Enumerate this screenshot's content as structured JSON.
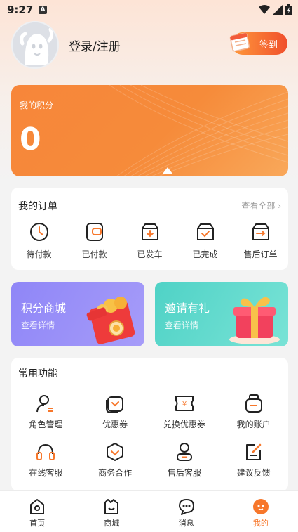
{
  "status_bar": {
    "time": "9:27",
    "notif_badge": "A"
  },
  "profile": {
    "login_text": "登录/注册",
    "signin_label": "签到"
  },
  "points": {
    "title": "我的积分",
    "value": "0"
  },
  "orders": {
    "title": "我的订单",
    "view_all": "查看全部 ›",
    "items": [
      {
        "label": "待付款",
        "icon": "clock-icon"
      },
      {
        "label": "已付款",
        "icon": "card-icon"
      },
      {
        "label": "已发车",
        "icon": "box-down-icon"
      },
      {
        "label": "已完成",
        "icon": "box-check-icon"
      },
      {
        "label": "售后订单",
        "icon": "box-return-icon"
      }
    ]
  },
  "promos": {
    "points_mall": {
      "title": "积分商城",
      "sub": "查看详情"
    },
    "invite": {
      "title": "邀请有礼",
      "sub": "查看详情"
    }
  },
  "common": {
    "title": "常用功能",
    "items": [
      {
        "label": "角色管理",
        "icon": "user-role-icon"
      },
      {
        "label": "优惠券",
        "icon": "coupon-icon"
      },
      {
        "label": "兑换优惠券",
        "icon": "ticket-yen-icon"
      },
      {
        "label": "我的账户",
        "icon": "wallet-icon"
      },
      {
        "label": "在线客服",
        "icon": "headset-icon"
      },
      {
        "label": "商务合作",
        "icon": "handshake-icon"
      },
      {
        "label": "售后客服",
        "icon": "service-person-icon"
      },
      {
        "label": "建议反馈",
        "icon": "feedback-edit-icon"
      }
    ]
  },
  "tabs": [
    {
      "label": "首页",
      "icon": "home-icon"
    },
    {
      "label": "商城",
      "icon": "shop-icon"
    },
    {
      "label": "消息",
      "icon": "message-icon"
    },
    {
      "label": "我的",
      "icon": "profile-icon"
    }
  ],
  "colors": {
    "accent": "#f7772b",
    "points_card": "#f68b3a",
    "promo_purple": "#9a90f8",
    "promo_teal": "#5fd9cc"
  }
}
